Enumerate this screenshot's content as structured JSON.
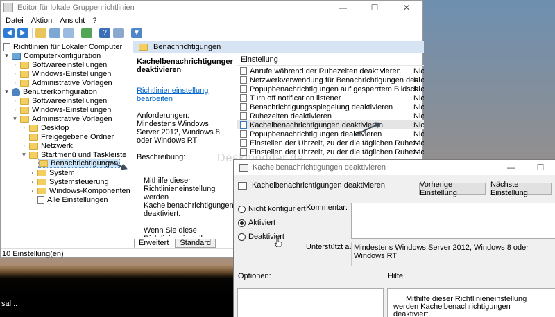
{
  "window": {
    "title": "Editor für lokale Gruppenrichtlinien",
    "minimize": "—",
    "maximize": "☐",
    "close": "✕"
  },
  "menu": [
    "Datei",
    "Aktion",
    "Ansicht",
    "?"
  ],
  "tree": [
    {
      "label": "Richtlinien für Lokaler Computer",
      "icon": "policy-doc-icon"
    },
    {
      "label": "Computerkonfiguration",
      "icon": "computer-icon"
    },
    {
      "label": "Softwareeinstellungen",
      "icon": "folder-icon"
    },
    {
      "label": "Windows-Einstellungen",
      "icon": "folder-icon"
    },
    {
      "label": "Administrative Vorlagen",
      "icon": "folder-icon"
    },
    {
      "label": "Benutzerkonfiguration",
      "icon": "user-icon"
    },
    {
      "label": "Softwareeinstellungen",
      "icon": "folder-icon"
    },
    {
      "label": "Windows-Einstellungen",
      "icon": "folder-icon"
    },
    {
      "label": "Administrative Vorlagen",
      "icon": "folder-icon"
    },
    {
      "label": "Desktop",
      "icon": "folder-icon"
    },
    {
      "label": "Freigegebene Ordner",
      "icon": "folder-icon"
    },
    {
      "label": "Netzwerk",
      "icon": "folder-icon"
    },
    {
      "label": "Startmenü und Taskleiste",
      "icon": "folder-icon"
    },
    {
      "label": "Benachrichtigungen",
      "icon": "folder-open-icon"
    },
    {
      "label": "System",
      "icon": "folder-icon"
    },
    {
      "label": "Systemsteuerung",
      "icon": "folder-icon"
    },
    {
      "label": "Windows-Komponenten",
      "icon": "folder-icon"
    },
    {
      "label": "Alle Einstellungen",
      "icon": "settings-doc-icon"
    }
  ],
  "status": "10 Einstellung(en)",
  "right_header": "Benachrichtigungen",
  "description": {
    "title": "Kachelbenachrichtigungen deaktivieren",
    "link": "Richtlinieneinstellung bearbeiten",
    "requirements_label": "Anforderungen:",
    "requirements": "Mindestens Windows Server 2012, Windows 8 oder Windows RT",
    "desc_label": "Beschreibung:",
    "text1": "Mithilfe dieser Richtlinieneinstellung werden Kachelbenachrichtigungen deaktiviert.",
    "text2": "Wenn Sie diese Richtlinieneinstellung aktivieren, sind Anwendungen und Systemfeatures nicht in der Lage, ihre Kacheln und Kachelsignale auf dem Startbildschirm zu aktualisieren."
  },
  "tabs": [
    "Erweitert",
    "Standard"
  ],
  "policy_list": {
    "column": "Einstellung",
    "rows": [
      {
        "name": "Anrufe während der Ruhezeiten deaktivieren",
        "state": "Nic"
      },
      {
        "name": "Netzwerkverwendung für Benachrichtigungen deaktivieren",
        "state": "Nic"
      },
      {
        "name": "Popupbenachrichtigungen auf gesperrtem Bildschirm deakt...",
        "state": "Nic"
      },
      {
        "name": "Turn off notification listener",
        "state": "Nic"
      },
      {
        "name": "Benachrichtigungsspiegelung deaktivieren",
        "state": "Nic"
      },
      {
        "name": "Ruhezeiten deaktivieren",
        "state": "Nic"
      },
      {
        "name": "Kachelbenachrichtigungen deaktivieren",
        "state": "Nic"
      },
      {
        "name": "Popupbenachrichtigungen deaktivieren",
        "state": "Nic"
      },
      {
        "name": "Einstellen der Uhrzeit, zu der die täglichen Ruhezeiten begin...",
        "state": "Nic"
      },
      {
        "name": "Einstellen der Uhrzeit, zu der die täglichen Ruhezeiten enden",
        "state": "Nic"
      }
    ]
  },
  "watermark": "Deskmodder.de",
  "dialog": {
    "title": "Kachelbenachrichtigungen deaktivieren",
    "subtitle": "Kachelbenachrichtigungen deaktivieren",
    "prev_button": "Vorherige Einstellung",
    "next_button": "Nächste Einstellung",
    "radio_not_configured": "Nicht konfiguriert",
    "radio_enabled": "Aktiviert",
    "radio_disabled": "Deaktiviert",
    "selected": "Aktiviert",
    "comment_label": "Kommentar:",
    "supported_label": "Unterstützt auf:",
    "supported_value": "Mindestens Windows Server 2012, Windows 8 oder Windows RT",
    "options_label": "Optionen:",
    "help_label": "Hilfe:",
    "help_text": "Mithilfe dieser Richtlinieneinstellung werden Kachelbenachrichtigungen deaktiviert.",
    "minimize": "—",
    "maximize": "☐"
  },
  "desktop_text": "sal..."
}
